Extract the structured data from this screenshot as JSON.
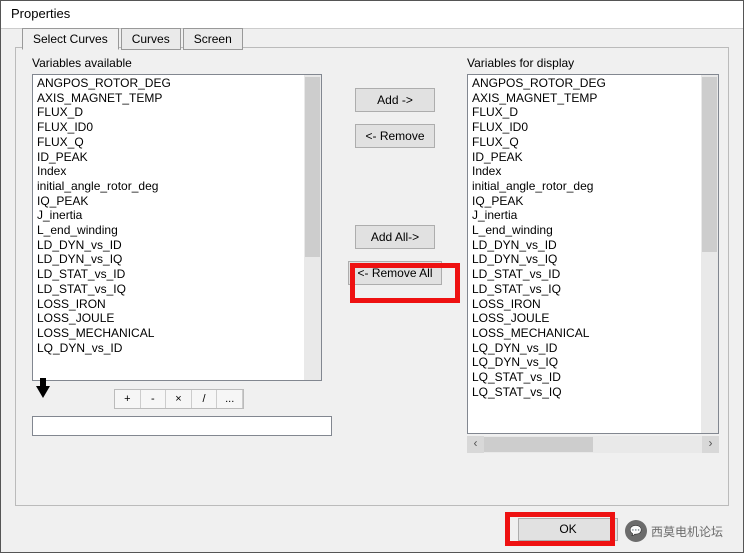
{
  "window": {
    "title": "Properties"
  },
  "tabs": {
    "t0": "Select Curves",
    "t1": "Curves",
    "t2": "Screen"
  },
  "labels": {
    "available": "Variables available",
    "display": "Variables for display"
  },
  "buttons": {
    "add": "Add ->",
    "remove": "<- Remove",
    "addall": "Add All->",
    "removeall": "<- Remove All",
    "ok": "OK"
  },
  "toolbar": {
    "t0": "+",
    "t1": "-",
    "t2": "×",
    "t3": "/",
    "t4": "..."
  },
  "left_items": {
    "i0": "ANGPOS_ROTOR_DEG",
    "i1": "AXIS_MAGNET_TEMP",
    "i2": "FLUX_D",
    "i3": "FLUX_ID0",
    "i4": "FLUX_Q",
    "i5": "ID_PEAK",
    "i6": "Index",
    "i7": "initial_angle_rotor_deg",
    "i8": "IQ_PEAK",
    "i9": "J_inertia",
    "i10": "L_end_winding",
    "i11": "LD_DYN_vs_ID",
    "i12": "LD_DYN_vs_IQ",
    "i13": "LD_STAT_vs_ID",
    "i14": "LD_STAT_vs_IQ",
    "i15": "LOSS_IRON",
    "i16": "LOSS_JOULE",
    "i17": "LOSS_MECHANICAL",
    "i18": "LQ_DYN_vs_ID"
  },
  "right_items": {
    "i0": "ANGPOS_ROTOR_DEG",
    "i1": "AXIS_MAGNET_TEMP",
    "i2": "FLUX_D",
    "i3": "FLUX_ID0",
    "i4": "FLUX_Q",
    "i5": "ID_PEAK",
    "i6": "Index",
    "i7": "initial_angle_rotor_deg",
    "i8": "IQ_PEAK",
    "i9": "J_inertia",
    "i10": "L_end_winding",
    "i11": "LD_DYN_vs_ID",
    "i12": "LD_DYN_vs_IQ",
    "i13": "LD_STAT_vs_ID",
    "i14": "LD_STAT_vs_IQ",
    "i15": "LOSS_IRON",
    "i16": "LOSS_JOULE",
    "i17": "LOSS_MECHANICAL",
    "i18": "LQ_DYN_vs_ID",
    "i19": "LQ_DYN_vs_IQ",
    "i20": "LQ_STAT_vs_ID",
    "i21": "LQ_STAT_vs_IQ"
  },
  "badge": {
    "text": "西莫电机论坛"
  }
}
